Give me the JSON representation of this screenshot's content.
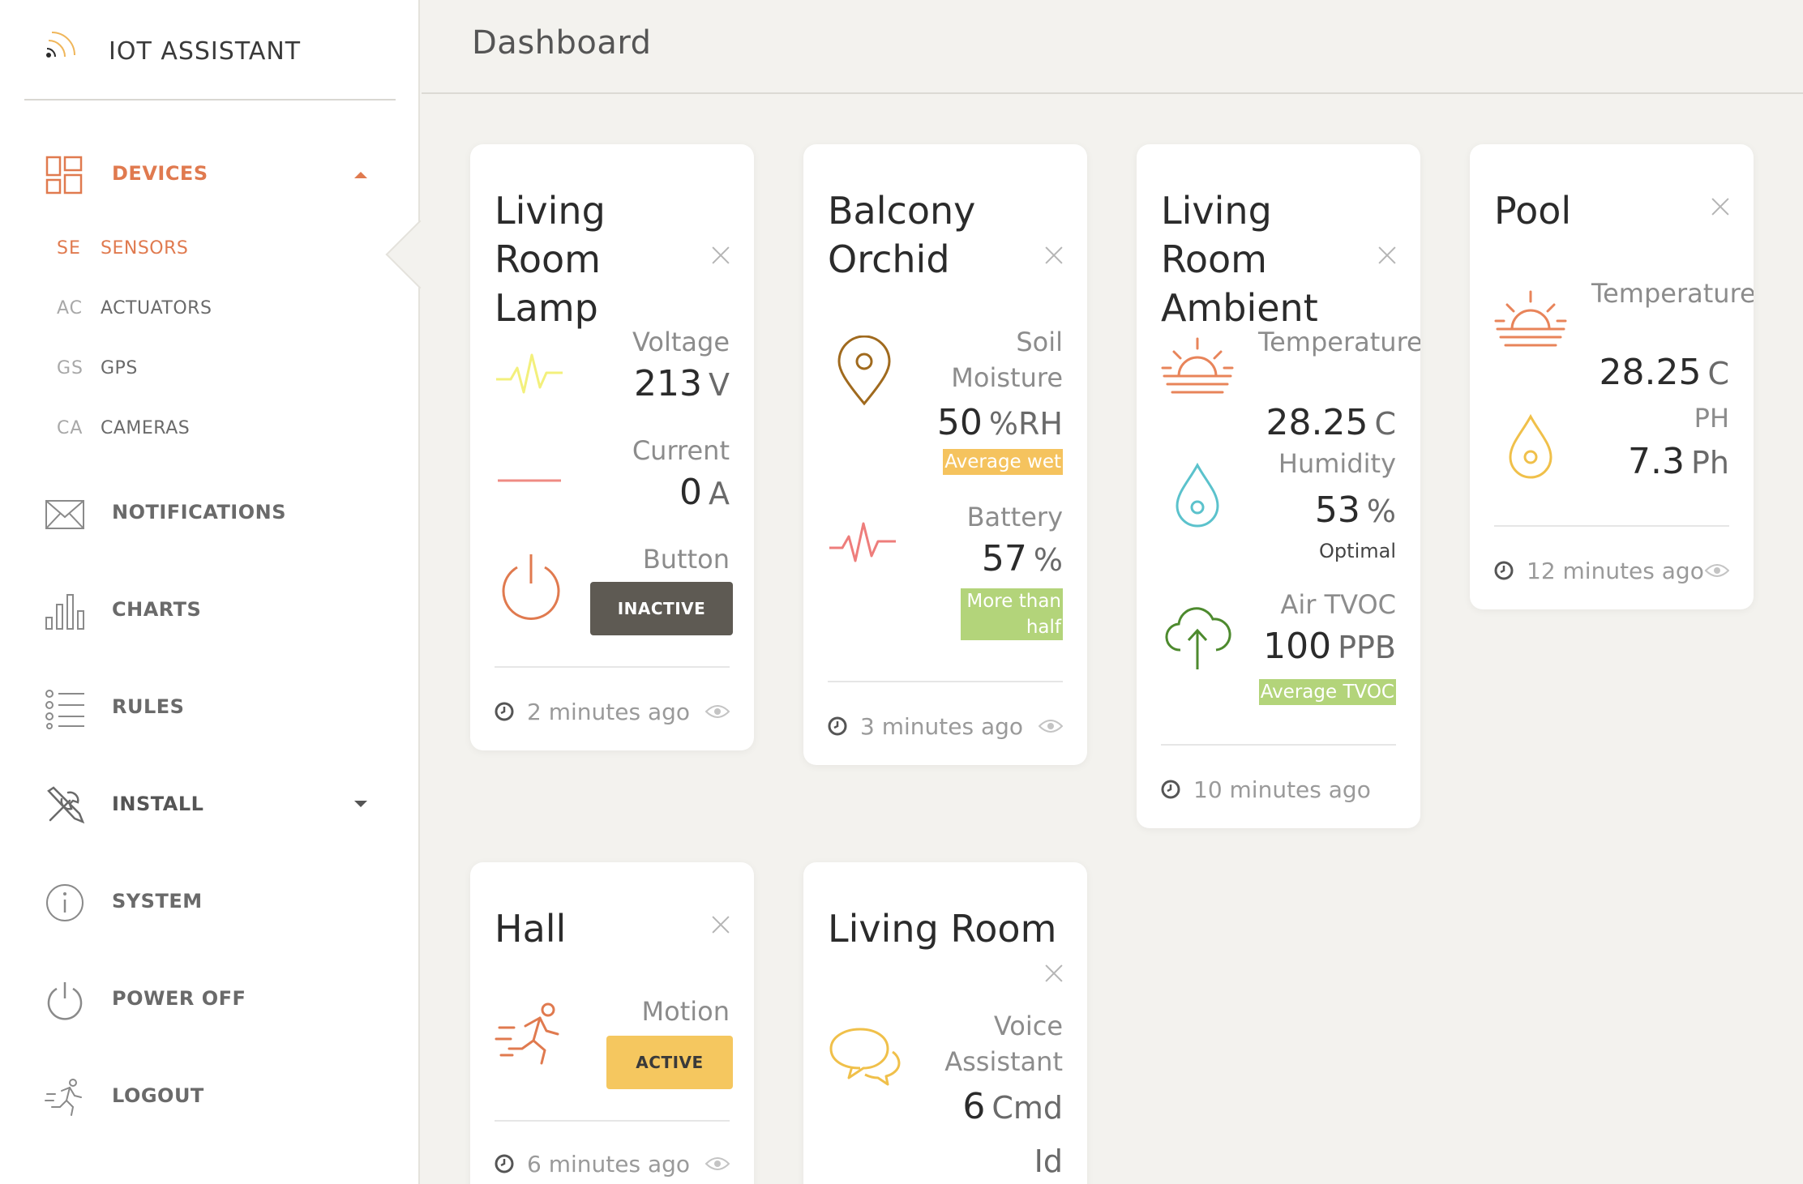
{
  "app": {
    "title": "IOT ASSISTANT"
  },
  "header": {
    "title": "Dashboard"
  },
  "sidebar": {
    "devices": {
      "label": "DEVICES"
    },
    "subitems": [
      {
        "abbr": "SE",
        "label": "SENSORS"
      },
      {
        "abbr": "AC",
        "label": "ACTUATORS"
      },
      {
        "abbr": "GS",
        "label": "GPS"
      },
      {
        "abbr": "CA",
        "label": "CAMERAS"
      }
    ],
    "items": [
      {
        "label": "NOTIFICATIONS"
      },
      {
        "label": "CHARTS"
      },
      {
        "label": "RULES"
      },
      {
        "label": "INSTALL"
      },
      {
        "label": "SYSTEM"
      },
      {
        "label": "POWER OFF"
      },
      {
        "label": "LOGOUT"
      }
    ]
  },
  "cards": {
    "lamp": {
      "title": "Living Room Lamp",
      "voltage": {
        "label": "Voltage",
        "value": "213",
        "unit": "V"
      },
      "current": {
        "label": "Current",
        "value": "0",
        "unit": "A"
      },
      "button": {
        "label": "Button",
        "state": "INACTIVE"
      },
      "updated": "2 minutes ago"
    },
    "orchid": {
      "title": "Balcony Orchid",
      "soil": {
        "label": "Soil Moisture",
        "value": "50",
        "unit": "%RH",
        "tag": "Average wet"
      },
      "battery": {
        "label": "Battery",
        "value": "57",
        "unit": "%",
        "tag": "More than half"
      },
      "updated": "3 minutes ago"
    },
    "ambient": {
      "title": "Living Room Ambient",
      "temperature": {
        "label": "Temperature",
        "value": "28.25",
        "unit": "C"
      },
      "humidity": {
        "label": "Humidity",
        "value": "53",
        "unit": "%",
        "note": "Optimal"
      },
      "tvoc": {
        "label": "Air TVOC",
        "value": "100",
        "unit": "PPB",
        "tag": "Average TVOC"
      },
      "updated": "10 minutes ago"
    },
    "pool": {
      "title": "Pool",
      "temperature": {
        "label": "Temperature",
        "value": "28.25",
        "unit": "C"
      },
      "ph": {
        "label": "PH",
        "value": "7.3",
        "unit": "Ph"
      },
      "updated": "12 minutes ago"
    },
    "hall": {
      "title": "Hall",
      "motion": {
        "label": "Motion",
        "state": "ACTIVE"
      },
      "updated": "6 minutes ago"
    },
    "voice": {
      "title": "Living Room",
      "voice": {
        "label": "Voice Assistant",
        "value": "6",
        "unit": "Cmd",
        "extra": "Id"
      }
    }
  },
  "colors": {
    "accent": "#e07a4f",
    "tag_orange": "#f5c35e",
    "tag_green": "#b3d47a",
    "button_inactive": "#5e5a53",
    "button_active": "#f5c75f"
  }
}
